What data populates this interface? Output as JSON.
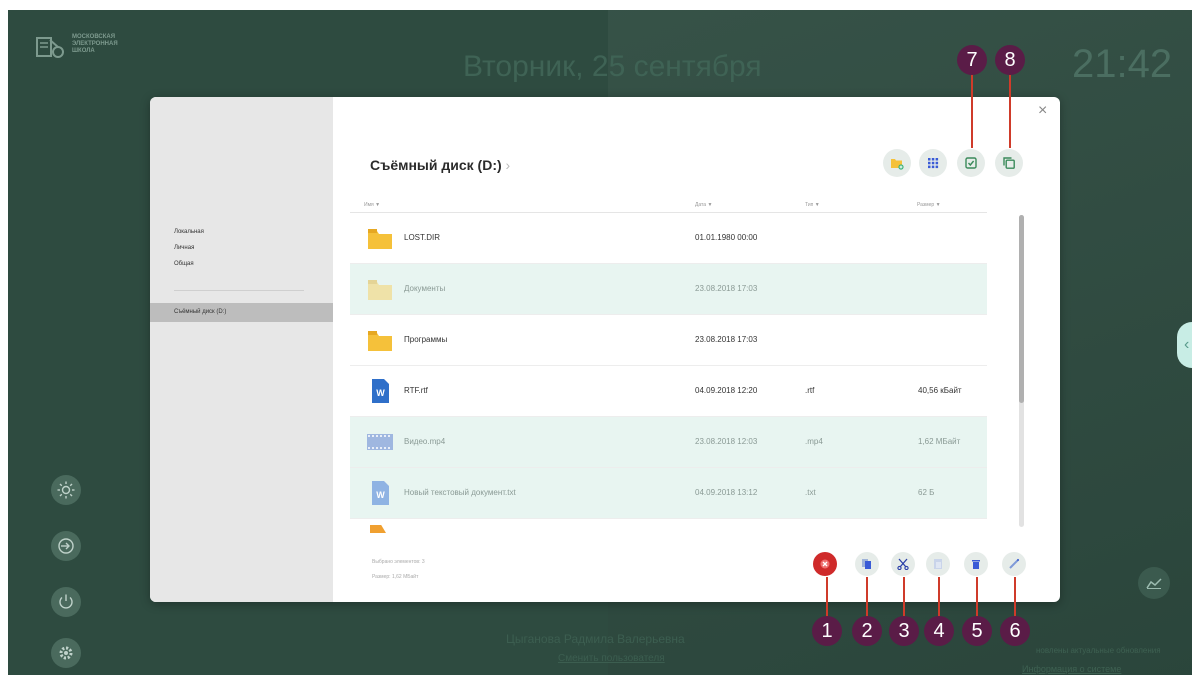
{
  "header": {
    "logo_lines": [
      "МОСКОВСКАЯ",
      "ЭЛЕКТРОННАЯ",
      "ШКОЛА"
    ],
    "date": "Вторник, 25 сентября",
    "time": "21:42"
  },
  "footer": {
    "user_name": "Цыганова Радмила Валерьевна",
    "change_user": "Сменить пользователя",
    "updates_text": "новлены актуальные обновления",
    "system_info": "Информация о системе"
  },
  "sidebar": {
    "items": [
      "Локальная",
      "Личная",
      "Общая"
    ],
    "selected": "Съёмный диск (D:)"
  },
  "dialog": {
    "breadcrumb": "Съёмный диск (D:)",
    "columns": {
      "name": "Имя ▼",
      "date": "Дата ▼",
      "type": "Тип ▼",
      "size": "Размер ▼"
    },
    "files": [
      {
        "name": "LOST.DIR",
        "date": "01.01.1980 00:00",
        "type": "",
        "size": "",
        "icon": "folder-icon",
        "selected": false
      },
      {
        "name": "Документы",
        "date": "23.08.2018 17:03",
        "type": "",
        "size": "",
        "icon": "folder-icon",
        "selected": true
      },
      {
        "name": "Программы",
        "date": "23.08.2018 17:03",
        "type": "",
        "size": "",
        "icon": "folder-icon",
        "selected": false
      },
      {
        "name": "RTF.rtf",
        "date": "04.09.2018 12:20",
        "type": ".rtf",
        "size": "40,56 кБайт",
        "icon": "word-doc-icon",
        "selected": false
      },
      {
        "name": "Видео.mp4",
        "date": "23.08.2018 12:03",
        "type": ".mp4",
        "size": "1,62 МБайт",
        "icon": "video-file-icon",
        "selected": true
      },
      {
        "name": "Новый текстовый документ.txt",
        "date": "04.09.2018 13:12",
        "type": ".txt",
        "size": "62 Б",
        "icon": "word-doc-icon",
        "selected": true
      }
    ],
    "status": {
      "selected_count": "Выбрано элементов: 3",
      "total_size": "Размер: 1,62 МБайт"
    }
  },
  "annotations": [
    "1",
    "2",
    "3",
    "4",
    "5",
    "6",
    "7",
    "8"
  ],
  "colors": {
    "background": "#2e4b40",
    "selection": "#e8f5f1",
    "badge": "#5a1c47",
    "leader_line": "#cf3b2a",
    "cancel": "#cf2a2a",
    "folder": "#f5c13a",
    "word": "#2f6fc9"
  }
}
